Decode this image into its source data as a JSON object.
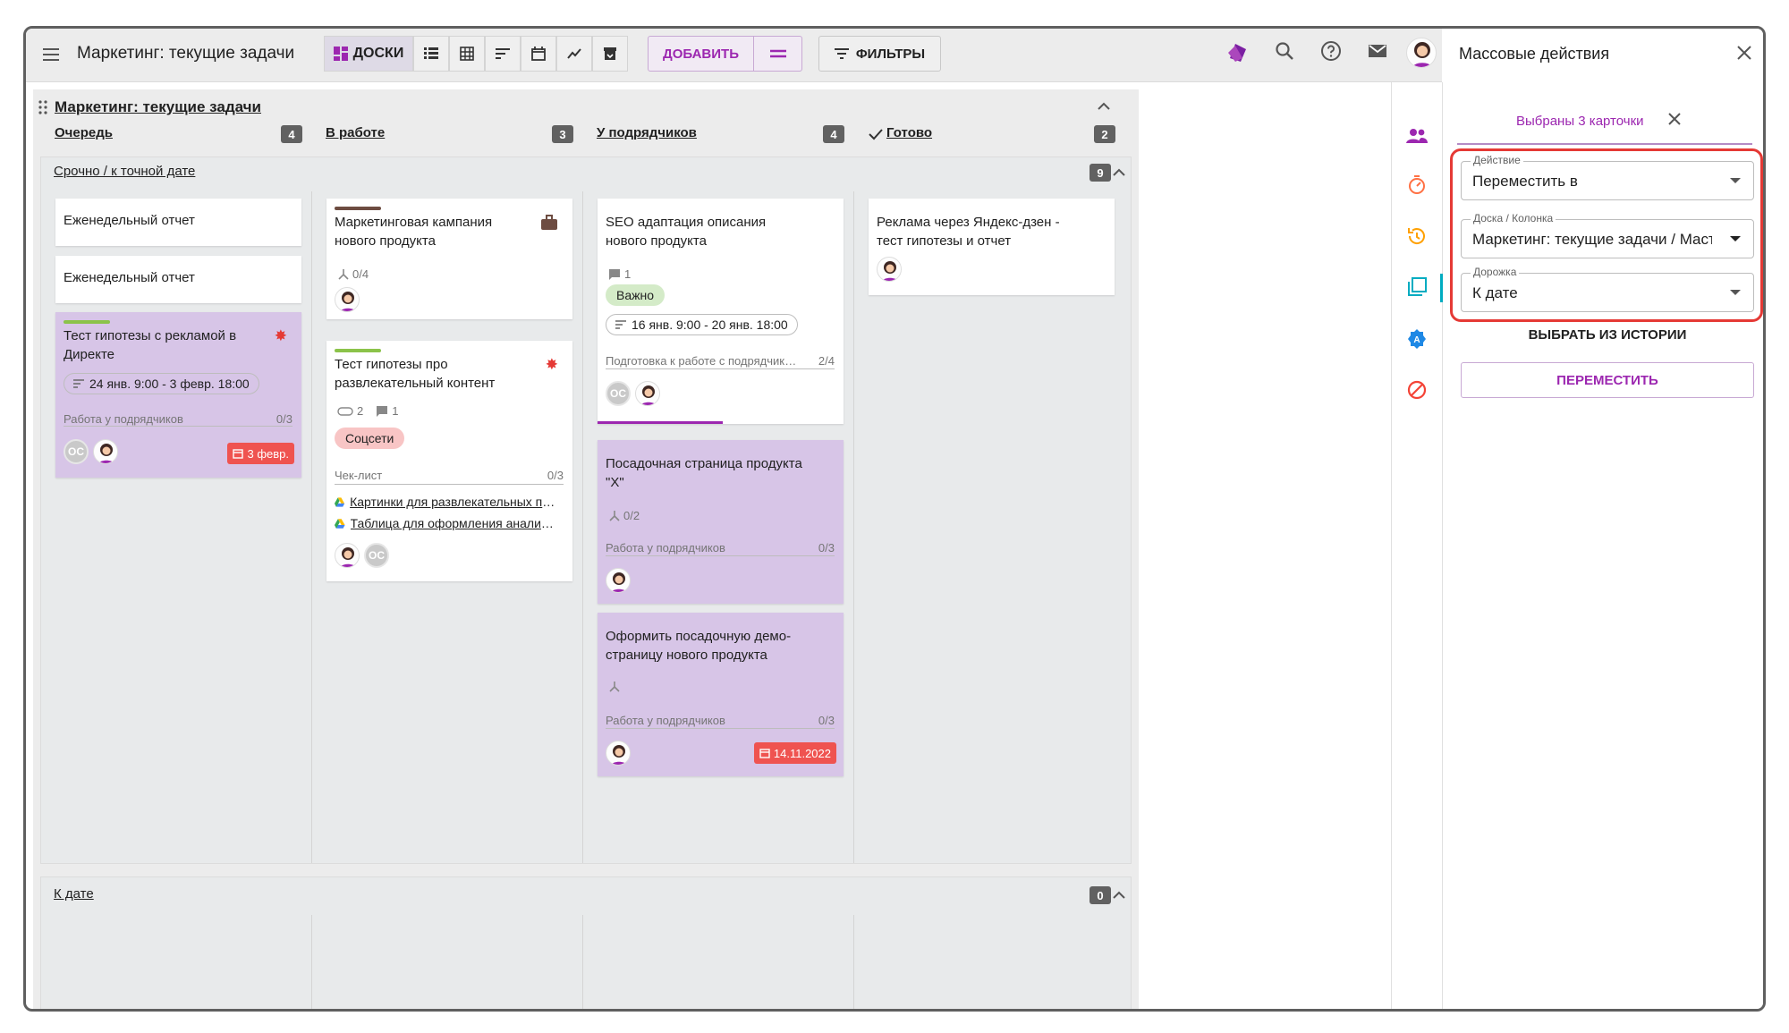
{
  "header": {
    "board_title": "Маркетинг: текущие задачи",
    "boards_label": "ДОСКИ",
    "add_label": "ДОБАВИТЬ",
    "filters_label": "ФИЛЬТРЫ"
  },
  "board": {
    "title": "Маркетинг: текущие задачи",
    "columns": [
      {
        "label": "Очередь",
        "count": "4"
      },
      {
        "label": "В работе",
        "count": "3"
      },
      {
        "label": "У подрядчиков",
        "count": "4"
      },
      {
        "label": "Готово",
        "count": "2"
      }
    ],
    "lanes": [
      {
        "label": "Срочно / к точной дате",
        "count": "9"
      },
      {
        "label": "К дате",
        "count": "0"
      }
    ]
  },
  "cards": {
    "c1": {
      "title": "Еженедельный отчет"
    },
    "c2": {
      "title": "Еженедельный отчет"
    },
    "c3": {
      "title": "Тест гипотезы с рекламой в Директе",
      "dates": "24 янв. 9:00 - 3 февр. 18:00",
      "checklist": "Работа у подрядчиков",
      "progress": "0/3",
      "due": "3 февр.",
      "avatar_initials": "ОС"
    },
    "c4": {
      "title": "Маркетинговая кампания нового продукта",
      "subtasks": "0/4"
    },
    "c5": {
      "title": "Тест гипотезы про развлекательный контент",
      "attachments": "2",
      "comments": "1",
      "tag": "Соцсети",
      "checklist": "Чек-лист",
      "progress": "0/3",
      "link1": "Картинки для развлекательных постов",
      "link2": "Таблица для оформления аналитики",
      "avatar_initials": "ОС"
    },
    "c6": {
      "title": "SEO адаптация описания нового продукта",
      "comments": "1",
      "tag": "Важно",
      "dates": "16 янв. 9:00 - 20 янв. 18:00",
      "checklist": "Подготовка к работе с подрядчиками",
      "progress": "2/4",
      "avatar_initials": "ОС"
    },
    "c7": {
      "title": "Посадочная страница продукта \"Х\"",
      "subtasks": "0/2",
      "checklist": "Работа у подрядчиков",
      "progress": "0/3"
    },
    "c8": {
      "title": "Оформить посадочную демо-страницу нового продукта",
      "checklist": "Работа у подрядчиков",
      "progress": "0/3",
      "due": "14.11.2022"
    },
    "c9": {
      "title": "Реклама через Яндекс-дзен - тест гипотезы и отчет"
    }
  },
  "panel": {
    "title": "Массовые действия",
    "selected": "Выбраны 3 карточки",
    "action_label": "Действие",
    "action_value": "Переместить в",
    "board_label": "Доска / Колонка",
    "board_value": "Маркетинг: текущие задачи / Мастер",
    "lane_label": "Дорожка",
    "lane_value": "К дате",
    "history_label": "ВЫБРАТЬ ИЗ ИСТОРИИ",
    "move_label": "ПЕРЕМЕСТИТЬ"
  },
  "colors": {
    "accent": "#9c27b0",
    "card_selected": "#d7c5e7",
    "due": "#ef5350",
    "highlight": "#e53935"
  }
}
